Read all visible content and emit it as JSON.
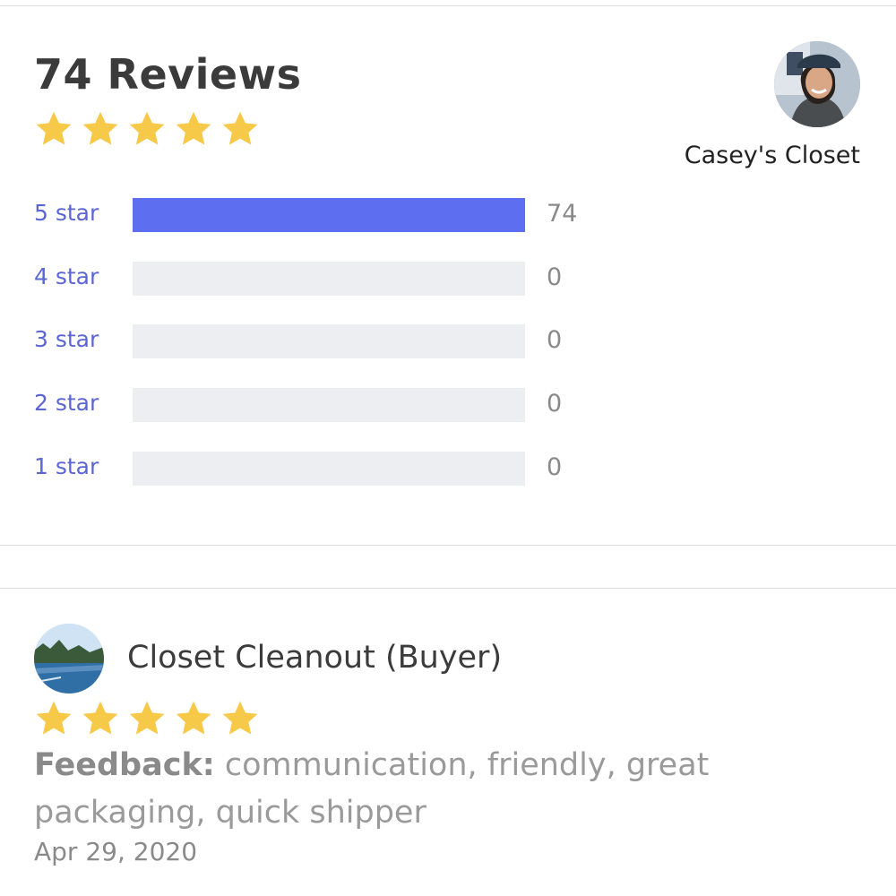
{
  "summary": {
    "title": "74 Reviews",
    "rating": 5,
    "star_color": "#f7c948"
  },
  "seller": {
    "name": "Casey's Closet"
  },
  "distribution": [
    {
      "label": "5 star",
      "count": "74",
      "fraction": 1.0
    },
    {
      "label": "4 star",
      "count": "0",
      "fraction": 0
    },
    {
      "label": "3 star",
      "count": "0",
      "fraction": 0
    },
    {
      "label": "2 star",
      "count": "0",
      "fraction": 0
    },
    {
      "label": "1 star",
      "count": "0",
      "fraction": 0
    }
  ],
  "colors": {
    "accent": "#5e6ef0",
    "label": "#5b65d3",
    "track": "#eceef2"
  },
  "review": {
    "reviewer": "Closet Cleanout (Buyer)",
    "rating": 5,
    "feedback_label": "Feedback:",
    "feedback_text": "communication, friendly, great packaging, quick shipper",
    "date": "Apr 29, 2020"
  }
}
